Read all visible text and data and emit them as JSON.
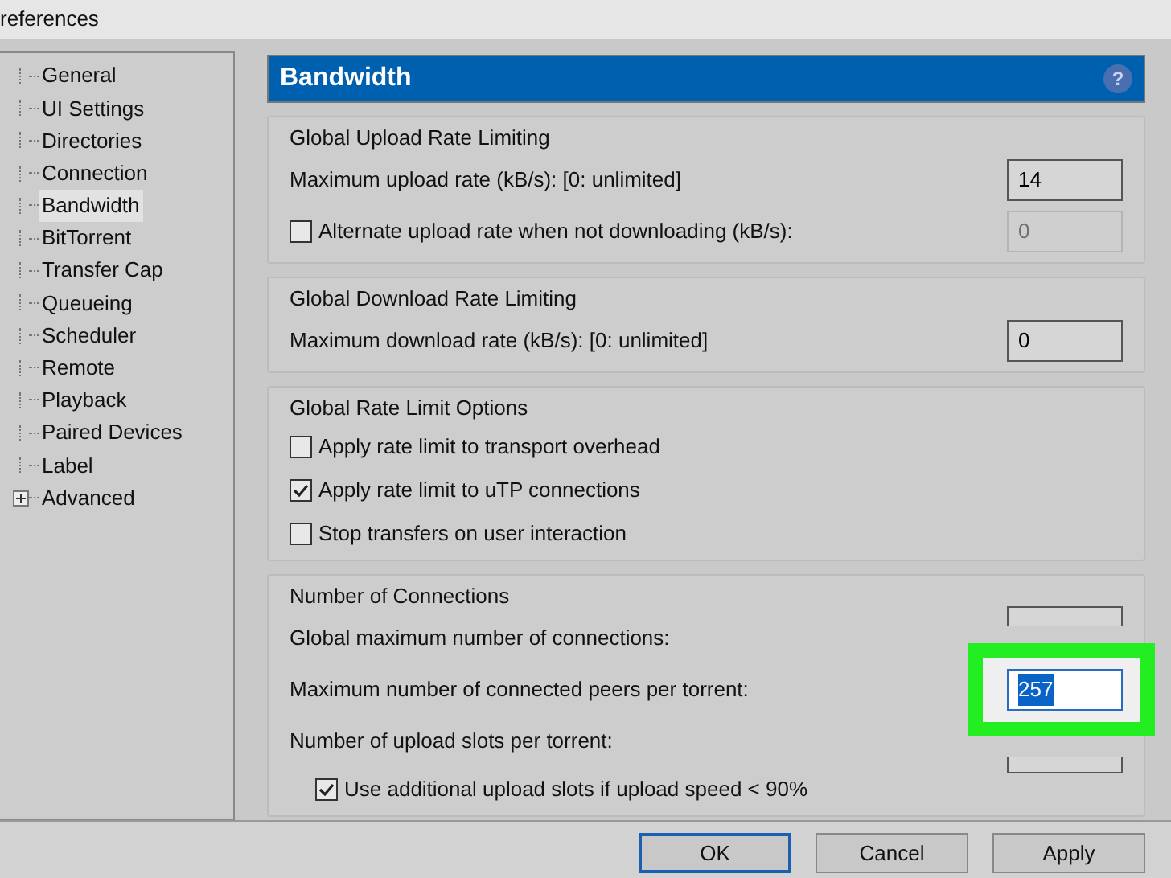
{
  "window": {
    "title": "references"
  },
  "sidebar": {
    "items": [
      {
        "label": "General",
        "selected": false
      },
      {
        "label": "UI Settings",
        "selected": false
      },
      {
        "label": "Directories",
        "selected": false
      },
      {
        "label": "Connection",
        "selected": false
      },
      {
        "label": "Bandwidth",
        "selected": true
      },
      {
        "label": "BitTorrent",
        "selected": false
      },
      {
        "label": "Transfer Cap",
        "selected": false
      },
      {
        "label": "Queueing",
        "selected": false
      },
      {
        "label": "Scheduler",
        "selected": false
      },
      {
        "label": "Remote",
        "selected": false
      },
      {
        "label": "Playback",
        "selected": false
      },
      {
        "label": "Paired Devices",
        "selected": false
      },
      {
        "label": "Label",
        "selected": false
      },
      {
        "label": "Advanced",
        "selected": false,
        "expandable": true
      }
    ]
  },
  "panel": {
    "title": "Bandwidth",
    "help": "?",
    "sections": [
      {
        "title": "Global Upload Rate Limiting",
        "rows": [
          {
            "kind": "field",
            "label": "Maximum upload rate (kB/s): [0: unlimited]",
            "value": "14",
            "disabled": false,
            "highlighted": false
          },
          {
            "kind": "checkfield",
            "label": "Alternate upload rate when not downloading (kB/s):",
            "checked": false,
            "value": "0",
            "disabled": true,
            "highlighted": false
          }
        ]
      },
      {
        "title": "Global Download Rate Limiting",
        "rows": [
          {
            "kind": "field",
            "label": "Maximum download rate (kB/s): [0: unlimited]",
            "value": "0",
            "disabled": false,
            "highlighted": false
          }
        ]
      },
      {
        "title": "Global Rate Limit Options",
        "rows": [
          {
            "kind": "checkbox",
            "label": "Apply rate limit to transport overhead",
            "checked": false
          },
          {
            "kind": "checkbox",
            "label": "Apply rate limit to uTP connections",
            "checked": true
          },
          {
            "kind": "checkbox",
            "label": "Stop transfers on user interaction",
            "checked": false
          }
        ]
      },
      {
        "title": "Number of Connections",
        "rows": [
          {
            "kind": "field",
            "label": "Global maximum number of connections:",
            "disabled": false,
            "highlighted": false
          },
          {
            "kind": "field",
            "label": "Maximum number of connected peers per torrent:",
            "value": "257",
            "disabled": false,
            "highlighted": true
          },
          {
            "kind": "field",
            "label": "Number of upload slots per torrent:",
            "disabled": false,
            "highlighted": false
          },
          {
            "kind": "subcheckbox",
            "label": "Use additional upload slots if upload speed < 90%",
            "checked": true
          }
        ]
      }
    ]
  },
  "buttons": [
    {
      "label": "OK",
      "default": true
    },
    {
      "label": "Cancel",
      "default": false
    },
    {
      "label": "Apply",
      "default": false
    }
  ]
}
